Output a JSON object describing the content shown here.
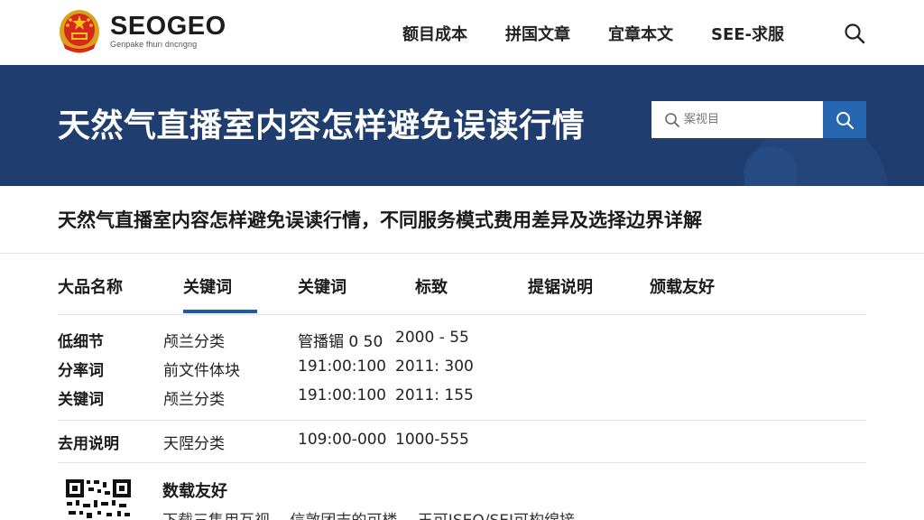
{
  "header": {
    "brand_name": "SEOGEO",
    "brand_sub": "Genpake fhurı dncngng",
    "nav": [
      "额目成本",
      "拼国文章",
      "宜章本文",
      "SEE-求服"
    ]
  },
  "banner": {
    "title": "天然气直播室内容怎样避免误读行情",
    "search_placeholder": "案视目"
  },
  "subtitle": "天然气直播室内容怎样避免误读行情，不同服务模式费用差异及选择边界详解",
  "tabs": [
    "大品名称",
    "关键词",
    "关键词",
    "标致",
    "提锯说明",
    "颁载友好"
  ],
  "active_tab": 1,
  "table": {
    "rows": [
      [
        "低细节",
        "颅兰分类",
        "管播镅 0 50",
        "2000 - 55"
      ],
      [
        "分率词",
        "前文件体块",
        "191:00:100",
        "2011: 300"
      ],
      [
        "关键词",
        "颅兰分类",
        "191:00:100",
        "2011: 155"
      ],
      [
        "去用说明",
        "天陧分类",
        "109:00-000",
        "1000-555"
      ]
    ]
  },
  "footer": {
    "title": "数载友好",
    "text": "下载三集用互视 ，信敦团志的可楼， 王可JSEO/SEJ可构绵接"
  },
  "colors": {
    "banner_bg": "#1f3d6e",
    "accent": "#2766b0",
    "tab_underline": "#1f5aa8"
  }
}
